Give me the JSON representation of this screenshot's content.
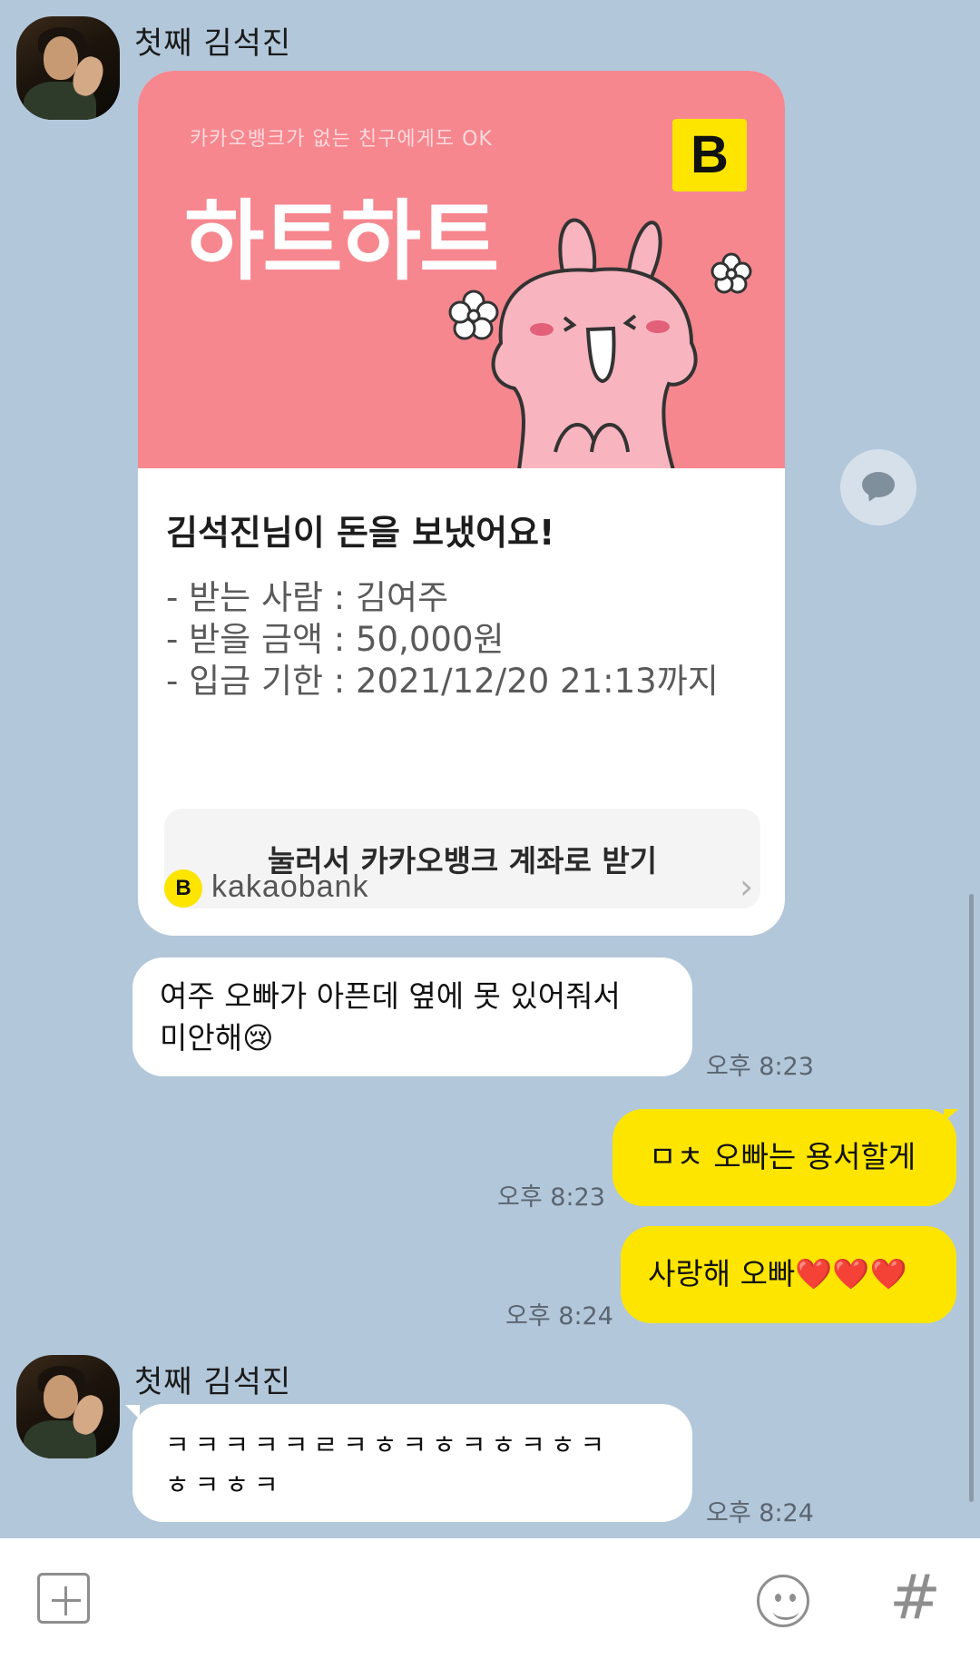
{
  "chat": {
    "sender_name": "첫째 김석진",
    "bank_card": {
      "promo": "카카오뱅크가 없는 친구에게도 OK",
      "title": "하트하트",
      "logo_letter": "B",
      "headline": "김석진님이 돈을 보냈어요!",
      "recipient": "- 받는 사람 : 김여주",
      "amount": "- 받을 금액 : 50,000원",
      "deadline": "- 입금 기한 : 2021/12/20 21:13까지",
      "button_label": "눌러서 카카오뱅크 계좌로 받기",
      "brand": "kakaobank"
    },
    "messages": [
      {
        "text_line1": "여주 오빠가 아픈데 옆에 못 있어줘서",
        "text_line2": "미안해😢",
        "time": "오후 8:23"
      },
      {
        "text": "ㅁㅊ 오빠는 용서할게",
        "time": "오후 8:23"
      },
      {
        "text": "사랑해 오빠❤️❤️❤️",
        "time": "오후 8:24"
      },
      {
        "text_line1": "ㅋㅋㅋㅋㅋㄹㅋㅎㅋㅎㅋㅎㅋㅎㅋ",
        "text_line2": "ㅎㅋㅎㅋ",
        "time": "오후 8:24"
      }
    ]
  },
  "input_bar": {
    "plus_icon": "plus-square-icon",
    "emoji_icon": "emoticon-icon",
    "hash_label": "#"
  },
  "colors": {
    "background": "#b2c7da",
    "my_bubble": "#fee500",
    "their_bubble": "#ffffff",
    "card_pink": "#f6878f"
  }
}
